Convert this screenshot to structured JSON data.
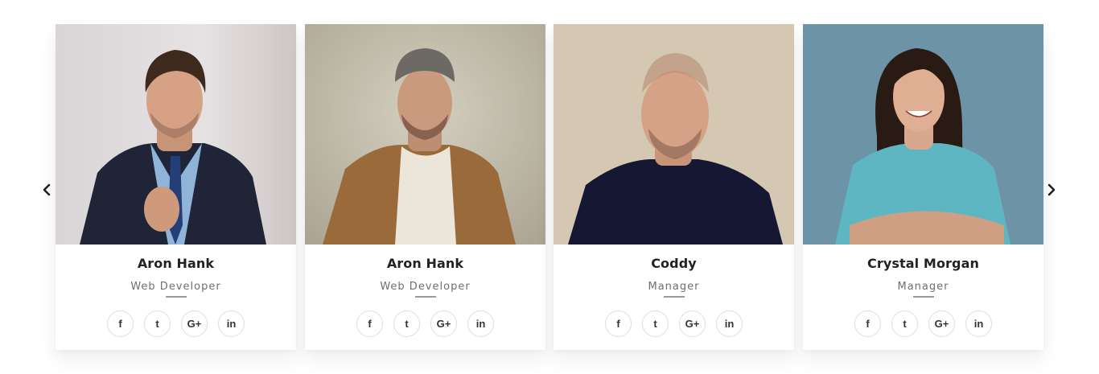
{
  "team": {
    "members": [
      {
        "name": "Aron Hank",
        "role": "Web Developer"
      },
      {
        "name": "Aron Hank",
        "role": "Web Developer"
      },
      {
        "name": "Coddy",
        "role": "Manager"
      },
      {
        "name": "Crystal Morgan",
        "role": "Manager"
      }
    ],
    "social_glyphs": {
      "facebook": "f",
      "twitter": "t",
      "googleplus": "G+",
      "linkedin": "in"
    }
  },
  "icons": {
    "prev": "chevron-left-icon",
    "next": "chevron-right-icon",
    "social": [
      "facebook-icon",
      "twitter-icon",
      "google-plus-icon",
      "linkedin-icon"
    ]
  },
  "colors": {
    "text_dark": "#222222",
    "text_muted": "#6f6f6f",
    "divider": "#9a9a9a",
    "circle_border": "#dedede",
    "photo_backgrounds": [
      "#e2dede",
      "#c3bcab",
      "#d6c9b4",
      "#6f95a8"
    ]
  }
}
